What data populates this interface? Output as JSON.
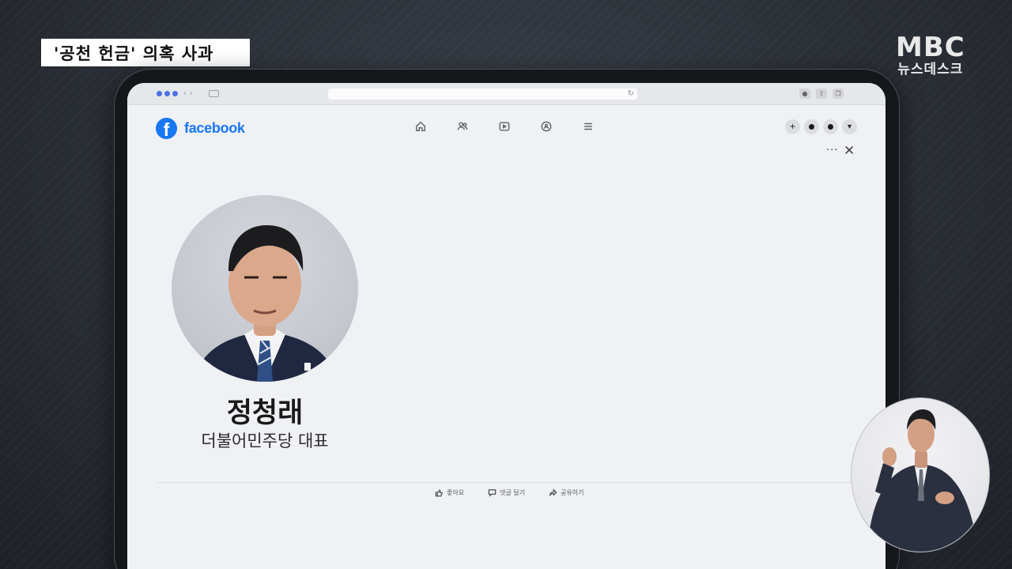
{
  "broadcast": {
    "caption": "'공천 헌금' 의혹 사과",
    "logo_main": "MBC",
    "logo_sub": "뉴스데스크"
  },
  "facebook": {
    "logo_letter": "f",
    "wordmark": "facebook",
    "nav_icons": [
      "home-icon",
      "friends-icon",
      "watch-icon",
      "groups-icon",
      "menu-icon"
    ],
    "right_icons": [
      "plus-icon",
      "messenger-icon",
      "notifications-icon",
      "account-dropdown-icon"
    ],
    "more": "···",
    "close": "✕"
  },
  "profile": {
    "name": "정청래",
    "title": "더불어민주당 대표"
  },
  "actions": {
    "like": "좋아요",
    "comment": "댓글 달기",
    "share": "공유하기"
  }
}
